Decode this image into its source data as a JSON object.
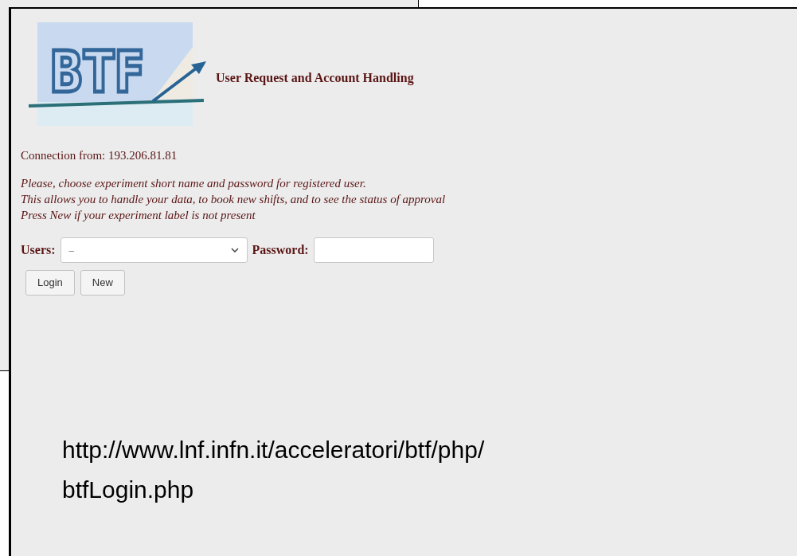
{
  "logo": {
    "text": "BTF"
  },
  "title": "User Request and Account Handling",
  "connection": "Connection from: 193.206.81.81",
  "instructions": [
    "Please, choose experiment short name and password for registered user.",
    "This allows you to handle your data, to book new shifts, and to see the status of approval",
    "Press New if your experiment label is not present"
  ],
  "form": {
    "users_label": "Users:",
    "users_value": "–",
    "password_label": "Password:"
  },
  "buttons": [
    "Login",
    "New"
  ],
  "caption": [
    "http://www.lnf.infn.it/acceleratori/btf/php/",
    "btfLogin.php"
  ]
}
